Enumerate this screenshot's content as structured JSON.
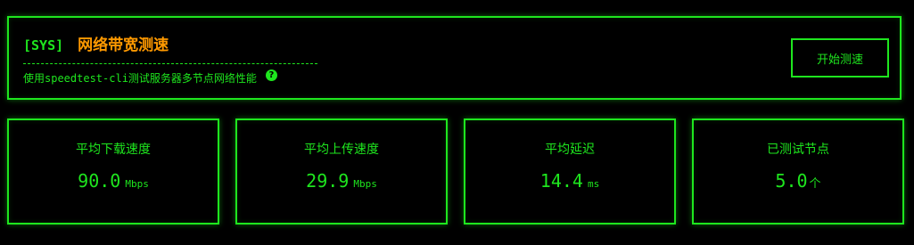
{
  "header": {
    "tag": "[SYS]",
    "title": "网络带宽测速",
    "subtitle": "使用speedtest-cli测试服务器多节点网络性能",
    "help_icon": "question-circle-icon",
    "start_button_label": "开始测速"
  },
  "stats": [
    {
      "label": "平均下载速度",
      "value": "90.0",
      "unit": "Mbps"
    },
    {
      "label": "平均上传速度",
      "value": "29.9",
      "unit": "Mbps"
    },
    {
      "label": "平均延迟",
      "value": "14.4",
      "unit": "ms"
    },
    {
      "label": "已测试节点",
      "value": "5.0",
      "unit": "个"
    }
  ],
  "colors": {
    "accent": "#1ee61e",
    "title": "#ff9900",
    "background": "#000000"
  }
}
